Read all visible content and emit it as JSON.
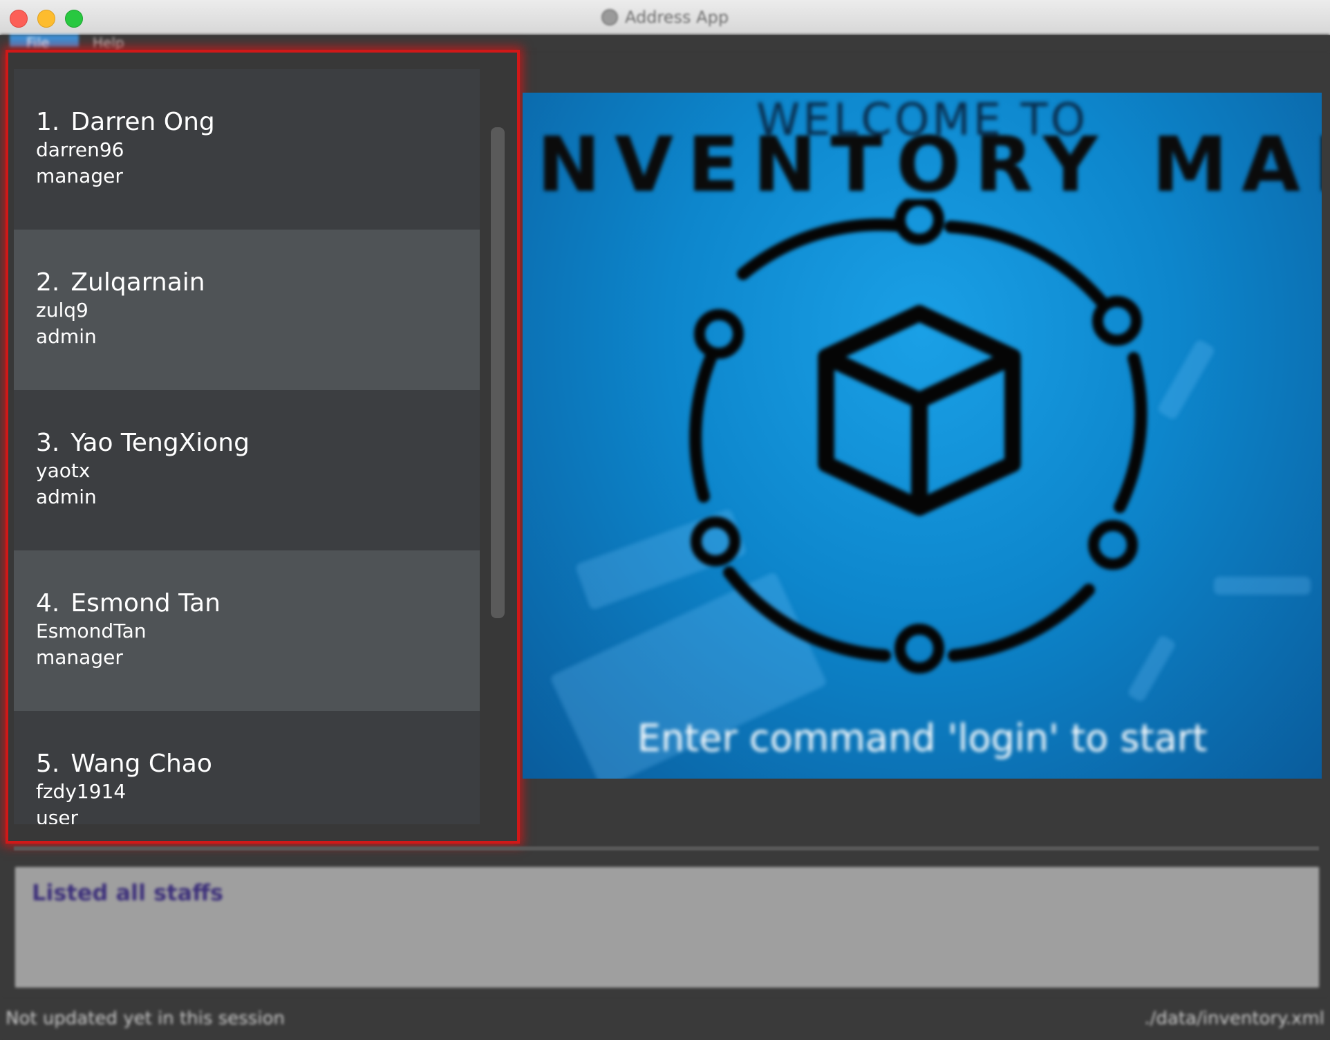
{
  "window": {
    "title": "Address App"
  },
  "menu": {
    "file_label": "File",
    "help_label": "Help"
  },
  "staff_list": [
    {
      "index": "1.",
      "name": "Darren Ong",
      "username": "darren96",
      "role": "manager"
    },
    {
      "index": "2.",
      "name": "Zulqarnain",
      "username": "zulq9",
      "role": "admin"
    },
    {
      "index": "3.",
      "name": "Yao TengXiong",
      "username": "yaotx",
      "role": "admin"
    },
    {
      "index": "4.",
      "name": "Esmond Tan",
      "username": "EsmondTan",
      "role": "manager"
    },
    {
      "index": "5.",
      "name": "Wang Chao",
      "username": "fzdy1914",
      "role": "user"
    }
  ],
  "welcome": {
    "subtitle": "WELCOME TO",
    "title": "INVENTORY MANAGER",
    "cta": "Enter command 'login' to start"
  },
  "result_display": {
    "text": "Listed all staffs"
  },
  "status_bar": {
    "sync_status": "Not updated yet in this session",
    "file_path": "./data/inventory.xml"
  },
  "colors": {
    "highlight_border": "#d01818",
    "card_dark": "#3c3e41",
    "card_light": "#4f5356",
    "welcome_blue": "#0d86cc"
  }
}
